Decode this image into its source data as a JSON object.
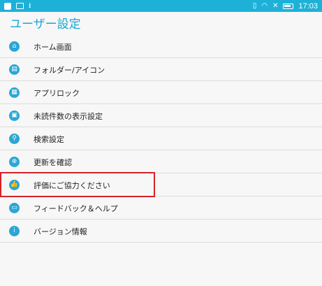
{
  "status_bar": {
    "time": "17:03",
    "left_icons": [
      "app-icon",
      "image-icon",
      "download-icon"
    ],
    "right_icons": [
      "vibrate-icon",
      "wifi-icon",
      "mute-icon",
      "battery-icon"
    ]
  },
  "header": {
    "title": "ユーザー設定"
  },
  "settings": {
    "items": [
      {
        "label": "ホーム画面",
        "icon": "home-icon"
      },
      {
        "label": "フォルダー/アイコン",
        "icon": "folder-icon"
      },
      {
        "label": "アプリロック",
        "icon": "app-lock-icon"
      },
      {
        "label": "未読件数の表示設定",
        "icon": "unread-badge-icon"
      },
      {
        "label": "検索設定",
        "icon": "search-icon"
      },
      {
        "label": "更新を確認",
        "icon": "update-search-icon"
      },
      {
        "label": "評価にご協力ください",
        "icon": "thumbs-up-icon"
      },
      {
        "label": "フィードバック＆ヘルプ",
        "icon": "feedback-icon"
      },
      {
        "label": "バージョン情報",
        "icon": "info-icon"
      }
    ]
  },
  "annotation": {
    "highlight_color": "#d6232a",
    "highlighted_item": "評価にご協力ください"
  },
  "colors": {
    "accent": "#1eb1d8",
    "title": "#18a7d2",
    "icon": "#2aa7d4"
  }
}
